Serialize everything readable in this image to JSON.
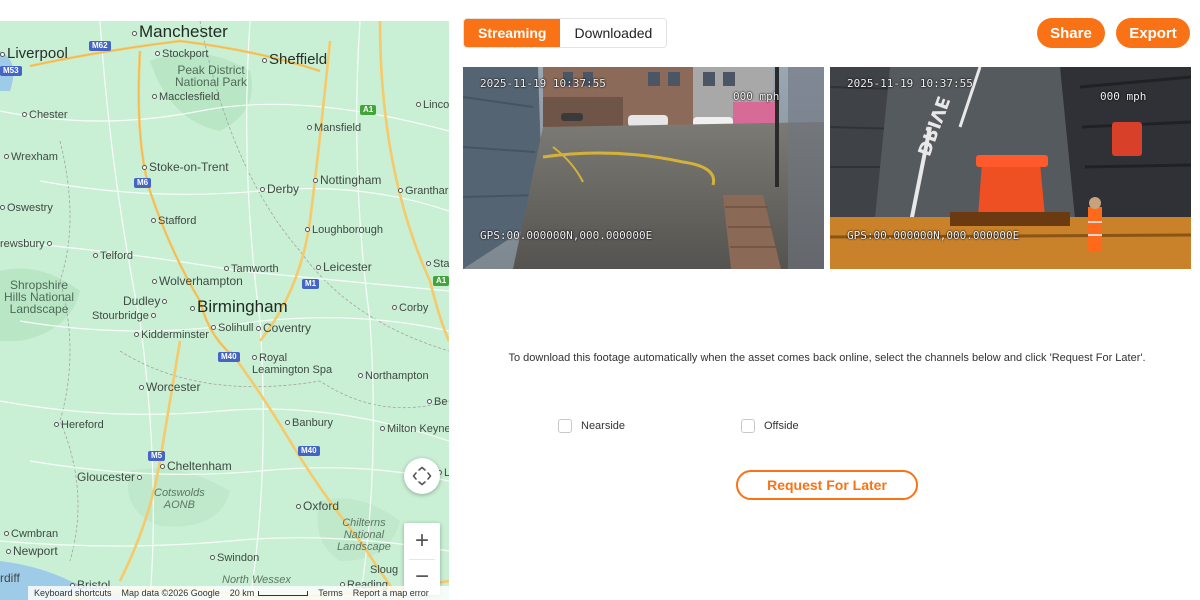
{
  "map": {
    "places": [
      {
        "name": "Manchester"
      },
      {
        "name": "Liverpool"
      },
      {
        "name": "Stockport"
      },
      {
        "name": "Sheffield"
      },
      {
        "name": "Macclesfield"
      },
      {
        "name": "Chester"
      },
      {
        "name": "Mansfield"
      },
      {
        "name": "Linco"
      },
      {
        "name": "Wrexham"
      },
      {
        "name": "Stoke-on-Trent"
      },
      {
        "name": "Nottingham"
      },
      {
        "name": "Derby"
      },
      {
        "name": "Granthar"
      },
      {
        "name": "Oswestry"
      },
      {
        "name": "Stafford"
      },
      {
        "name": "Loughborough"
      },
      {
        "name": "rewsbury"
      },
      {
        "name": "Telford"
      },
      {
        "name": "Tamworth"
      },
      {
        "name": "Leicester"
      },
      {
        "name": "Sta"
      },
      {
        "name": "Wolverhampton"
      },
      {
        "name": "Dudley"
      },
      {
        "name": "Birmingham"
      },
      {
        "name": "Corby"
      },
      {
        "name": "Stourbridge"
      },
      {
        "name": "Solihull"
      },
      {
        "name": "Coventry"
      },
      {
        "name": "Kidderminster"
      },
      {
        "name": "Royal\nLeamington Spa"
      },
      {
        "name": "Northampton"
      },
      {
        "name": "Worcester"
      },
      {
        "name": "Be"
      },
      {
        "name": "Hereford"
      },
      {
        "name": "Banbury"
      },
      {
        "name": "Milton Keyne"
      },
      {
        "name": "Cheltenham"
      },
      {
        "name": "Gloucester"
      },
      {
        "name": "L"
      },
      {
        "name": "Oxford"
      },
      {
        "name": "Cwmbran"
      },
      {
        "name": "Newport"
      },
      {
        "name": "Swindon"
      },
      {
        "name": "Sloug"
      },
      {
        "name": "rdiff"
      },
      {
        "name": "Bristol"
      },
      {
        "name": "Reading"
      }
    ],
    "regions": [
      {
        "name": "Peak District\nNational Park"
      },
      {
        "name": "Shropshire\nHills National\nLandscape"
      },
      {
        "name": "Cotswolds\nAONB"
      },
      {
        "name": "Chilterns\nNational\nLandscape"
      },
      {
        "name": "North Wessex"
      }
    ],
    "shields": [
      {
        "label": "M62",
        "kind": "m"
      },
      {
        "label": "M6",
        "kind": "m"
      },
      {
        "label": "M1",
        "kind": "m"
      },
      {
        "label": "M40",
        "kind": "m"
      },
      {
        "label": "M5",
        "kind": "m"
      },
      {
        "label": "M40",
        "kind": "m"
      },
      {
        "label": "A1",
        "kind": "a"
      },
      {
        "label": "A1",
        "kind": "a"
      },
      {
        "label": "M53",
        "kind": "m"
      }
    ],
    "controls": {
      "zoom_in": "+",
      "zoom_out": "−",
      "pan_icon": "pan-arrows-icon"
    },
    "footer": {
      "shortcuts": "Keyboard shortcuts",
      "map_data": "Map data ©2026 Google",
      "scale": "20 km",
      "terms": "Terms",
      "report": "Report a map error"
    },
    "colors": {
      "land": "#c9efd4",
      "water": "#9ecbe8",
      "motorway": "#f6c96a",
      "road": "#ffffff",
      "border": "#9b9b9b"
    }
  },
  "tabs": [
    {
      "label": "Streaming",
      "active": true
    },
    {
      "label": "Downloaded",
      "active": false
    }
  ],
  "actions": {
    "share": "Share",
    "export": "Export"
  },
  "feeds": [
    {
      "channel": "nearside",
      "timestamp": "2025-11-19 10:37:55",
      "speed": "000 mph",
      "gps": "GPS:00.000000N,000.000000E"
    },
    {
      "channel": "offside",
      "timestamp": "2025-11-19 10:37:55",
      "speed": "000 mph",
      "gps": "GPS:00.000000N,000.000000E"
    }
  ],
  "offline": {
    "message": "To download this footage automatically when the asset comes back online, select the channels below and click 'Request For Later'.",
    "channels": [
      {
        "label": "Nearside",
        "checked": false
      },
      {
        "label": "Offside",
        "checked": false
      }
    ],
    "request_label": "Request For Later"
  },
  "theme": {
    "accent": "#f97316"
  }
}
